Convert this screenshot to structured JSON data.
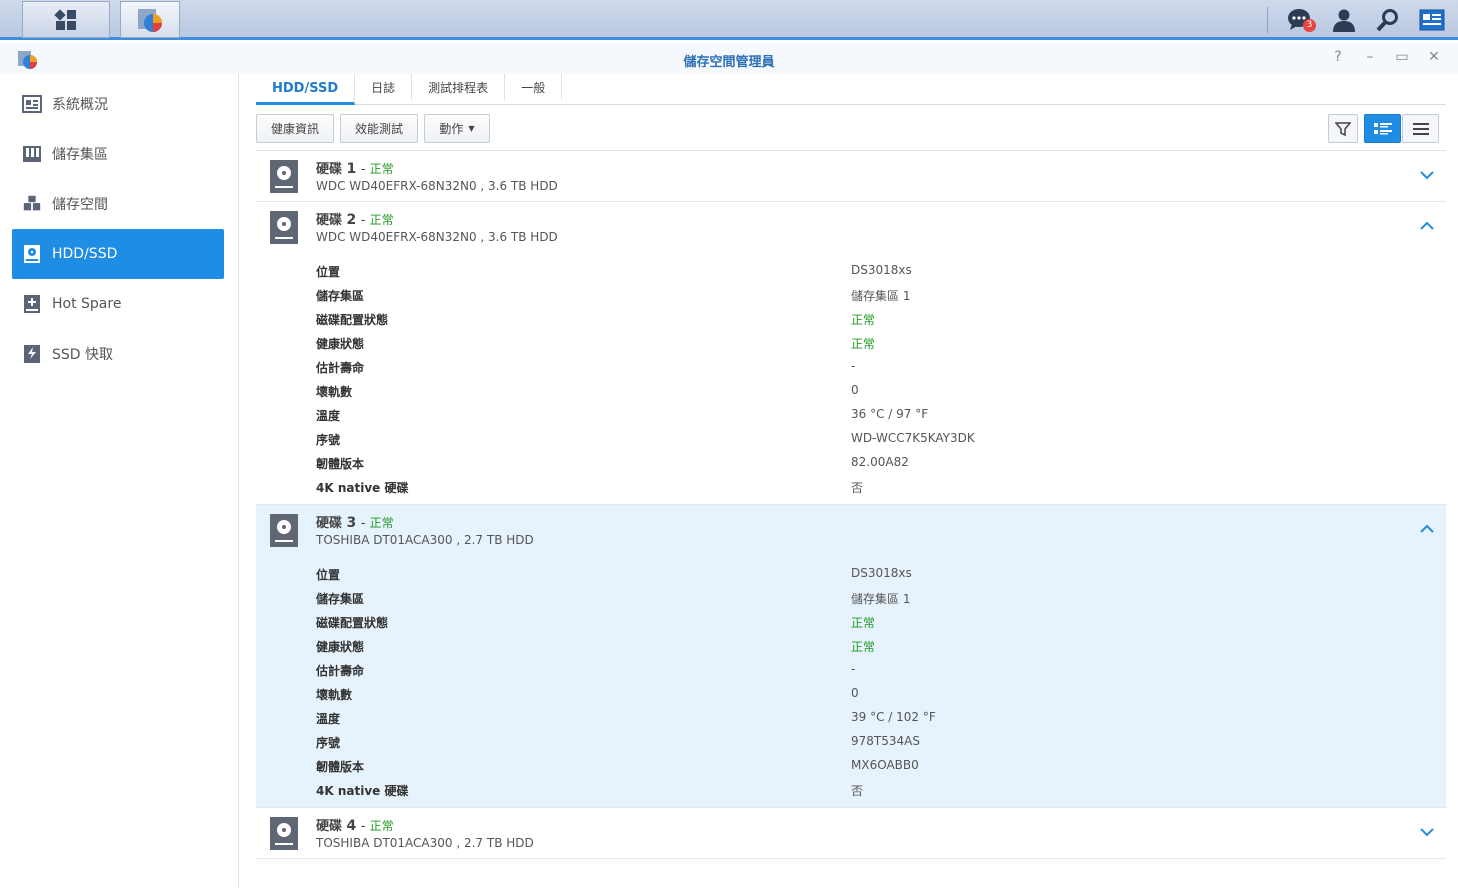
{
  "window": {
    "title": "儲存空間管理員"
  },
  "taskbar": {
    "notification_count": "3"
  },
  "sidebar": {
    "items": [
      {
        "label": "系統概況"
      },
      {
        "label": "儲存集區"
      },
      {
        "label": "儲存空間"
      },
      {
        "label": "HDD/SSD"
      },
      {
        "label": "Hot Spare"
      },
      {
        "label": "SSD 快取"
      }
    ]
  },
  "tabs": [
    {
      "label": "HDD/SSD"
    },
    {
      "label": "日誌"
    },
    {
      "label": "測試排程表"
    },
    {
      "label": "一般"
    }
  ],
  "toolbar": {
    "health": "健康資訊",
    "benchmark": "效能測試",
    "action": "動作"
  },
  "prop_labels": [
    "位置",
    "儲存集區",
    "磁碟配置狀態",
    "健康狀態",
    "估計壽命",
    "壞軌數",
    "溫度",
    "序號",
    "韌體版本",
    "4K native 硬碟"
  ],
  "disks": [
    {
      "label": "硬碟",
      "num": "1",
      "status": "正常",
      "model": "WDC WD40EFRX-68N32N0 , 3.6 TB HDD"
    },
    {
      "label": "硬碟",
      "num": "2",
      "status": "正常",
      "model": "WDC WD40EFRX-68N32N0 , 3.6 TB HDD",
      "props": [
        "DS3018xs",
        "儲存集區 1",
        "正常",
        "正常",
        "-",
        "0",
        "36 °C / 97 °F",
        "WD-WCC7K5KAY3DK",
        "82.00A82",
        "否"
      ]
    },
    {
      "label": "硬碟",
      "num": "3",
      "status": "正常",
      "model": "TOSHIBA DT01ACA300 , 2.7 TB HDD",
      "props": [
        "DS3018xs",
        "儲存集區 1",
        "正常",
        "正常",
        "-",
        "0",
        "39 °C / 102 °F",
        "978T534AS",
        "MX6OABB0",
        "否"
      ]
    },
    {
      "label": "硬碟",
      "num": "4",
      "status": "正常",
      "model": "TOSHIBA DT01ACA300 , 2.7 TB HDD"
    }
  ]
}
